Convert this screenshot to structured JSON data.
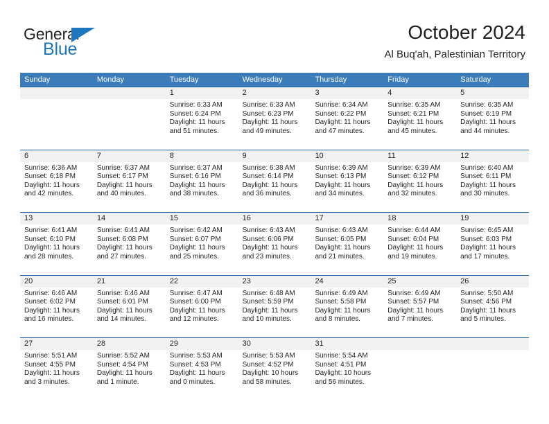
{
  "brand": {
    "name_top": "General",
    "name_bottom": "Blue",
    "accent_color": "#1e76bd"
  },
  "header": {
    "title": "October 2024",
    "subtitle": "Al Buq'ah, Palestinian Territory"
  },
  "theme": {
    "header_blue": "#3b7cb9",
    "rule_blue": "#1f5fa8",
    "day_band_gray": "#f1f1f1",
    "text_color": "#231f20"
  },
  "weekdays": [
    "Sunday",
    "Monday",
    "Tuesday",
    "Wednesday",
    "Thursday",
    "Friday",
    "Saturday"
  ],
  "weeks": [
    [
      {
        "day": "",
        "sunrise": "",
        "sunset": "",
        "daylight": "",
        "empty": true
      },
      {
        "day": "",
        "sunrise": "",
        "sunset": "",
        "daylight": "",
        "empty": true
      },
      {
        "day": "1",
        "sunrise": "Sunrise: 6:33 AM",
        "sunset": "Sunset: 6:24 PM",
        "daylight": "Daylight: 11 hours and 51 minutes."
      },
      {
        "day": "2",
        "sunrise": "Sunrise: 6:33 AM",
        "sunset": "Sunset: 6:23 PM",
        "daylight": "Daylight: 11 hours and 49 minutes."
      },
      {
        "day": "3",
        "sunrise": "Sunrise: 6:34 AM",
        "sunset": "Sunset: 6:22 PM",
        "daylight": "Daylight: 11 hours and 47 minutes."
      },
      {
        "day": "4",
        "sunrise": "Sunrise: 6:35 AM",
        "sunset": "Sunset: 6:21 PM",
        "daylight": "Daylight: 11 hours and 45 minutes."
      },
      {
        "day": "5",
        "sunrise": "Sunrise: 6:35 AM",
        "sunset": "Sunset: 6:19 PM",
        "daylight": "Daylight: 11 hours and 44 minutes."
      }
    ],
    [
      {
        "day": "6",
        "sunrise": "Sunrise: 6:36 AM",
        "sunset": "Sunset: 6:18 PM",
        "daylight": "Daylight: 11 hours and 42 minutes."
      },
      {
        "day": "7",
        "sunrise": "Sunrise: 6:37 AM",
        "sunset": "Sunset: 6:17 PM",
        "daylight": "Daylight: 11 hours and 40 minutes."
      },
      {
        "day": "8",
        "sunrise": "Sunrise: 6:37 AM",
        "sunset": "Sunset: 6:16 PM",
        "daylight": "Daylight: 11 hours and 38 minutes."
      },
      {
        "day": "9",
        "sunrise": "Sunrise: 6:38 AM",
        "sunset": "Sunset: 6:14 PM",
        "daylight": "Daylight: 11 hours and 36 minutes."
      },
      {
        "day": "10",
        "sunrise": "Sunrise: 6:39 AM",
        "sunset": "Sunset: 6:13 PM",
        "daylight": "Daylight: 11 hours and 34 minutes."
      },
      {
        "day": "11",
        "sunrise": "Sunrise: 6:39 AM",
        "sunset": "Sunset: 6:12 PM",
        "daylight": "Daylight: 11 hours and 32 minutes."
      },
      {
        "day": "12",
        "sunrise": "Sunrise: 6:40 AM",
        "sunset": "Sunset: 6:11 PM",
        "daylight": "Daylight: 11 hours and 30 minutes."
      }
    ],
    [
      {
        "day": "13",
        "sunrise": "Sunrise: 6:41 AM",
        "sunset": "Sunset: 6:10 PM",
        "daylight": "Daylight: 11 hours and 28 minutes."
      },
      {
        "day": "14",
        "sunrise": "Sunrise: 6:41 AM",
        "sunset": "Sunset: 6:08 PM",
        "daylight": "Daylight: 11 hours and 27 minutes."
      },
      {
        "day": "15",
        "sunrise": "Sunrise: 6:42 AM",
        "sunset": "Sunset: 6:07 PM",
        "daylight": "Daylight: 11 hours and 25 minutes."
      },
      {
        "day": "16",
        "sunrise": "Sunrise: 6:43 AM",
        "sunset": "Sunset: 6:06 PM",
        "daylight": "Daylight: 11 hours and 23 minutes."
      },
      {
        "day": "17",
        "sunrise": "Sunrise: 6:43 AM",
        "sunset": "Sunset: 6:05 PM",
        "daylight": "Daylight: 11 hours and 21 minutes."
      },
      {
        "day": "18",
        "sunrise": "Sunrise: 6:44 AM",
        "sunset": "Sunset: 6:04 PM",
        "daylight": "Daylight: 11 hours and 19 minutes."
      },
      {
        "day": "19",
        "sunrise": "Sunrise: 6:45 AM",
        "sunset": "Sunset: 6:03 PM",
        "daylight": "Daylight: 11 hours and 17 minutes."
      }
    ],
    [
      {
        "day": "20",
        "sunrise": "Sunrise: 6:46 AM",
        "sunset": "Sunset: 6:02 PM",
        "daylight": "Daylight: 11 hours and 16 minutes."
      },
      {
        "day": "21",
        "sunrise": "Sunrise: 6:46 AM",
        "sunset": "Sunset: 6:01 PM",
        "daylight": "Daylight: 11 hours and 14 minutes."
      },
      {
        "day": "22",
        "sunrise": "Sunrise: 6:47 AM",
        "sunset": "Sunset: 6:00 PM",
        "daylight": "Daylight: 11 hours and 12 minutes."
      },
      {
        "day": "23",
        "sunrise": "Sunrise: 6:48 AM",
        "sunset": "Sunset: 5:59 PM",
        "daylight": "Daylight: 11 hours and 10 minutes."
      },
      {
        "day": "24",
        "sunrise": "Sunrise: 6:49 AM",
        "sunset": "Sunset: 5:58 PM",
        "daylight": "Daylight: 11 hours and 8 minutes."
      },
      {
        "day": "25",
        "sunrise": "Sunrise: 6:49 AM",
        "sunset": "Sunset: 5:57 PM",
        "daylight": "Daylight: 11 hours and 7 minutes."
      },
      {
        "day": "26",
        "sunrise": "Sunrise: 5:50 AM",
        "sunset": "Sunset: 4:56 PM",
        "daylight": "Daylight: 11 hours and 5 minutes."
      }
    ],
    [
      {
        "day": "27",
        "sunrise": "Sunrise: 5:51 AM",
        "sunset": "Sunset: 4:55 PM",
        "daylight": "Daylight: 11 hours and 3 minutes."
      },
      {
        "day": "28",
        "sunrise": "Sunrise: 5:52 AM",
        "sunset": "Sunset: 4:54 PM",
        "daylight": "Daylight: 11 hours and 1 minute."
      },
      {
        "day": "29",
        "sunrise": "Sunrise: 5:53 AM",
        "sunset": "Sunset: 4:53 PM",
        "daylight": "Daylight: 11 hours and 0 minutes."
      },
      {
        "day": "30",
        "sunrise": "Sunrise: 5:53 AM",
        "sunset": "Sunset: 4:52 PM",
        "daylight": "Daylight: 10 hours and 58 minutes."
      },
      {
        "day": "31",
        "sunrise": "Sunrise: 5:54 AM",
        "sunset": "Sunset: 4:51 PM",
        "daylight": "Daylight: 10 hours and 56 minutes."
      },
      {
        "day": "",
        "sunrise": "",
        "sunset": "",
        "daylight": "",
        "empty": true
      },
      {
        "day": "",
        "sunrise": "",
        "sunset": "",
        "daylight": "",
        "empty": true
      }
    ]
  ]
}
